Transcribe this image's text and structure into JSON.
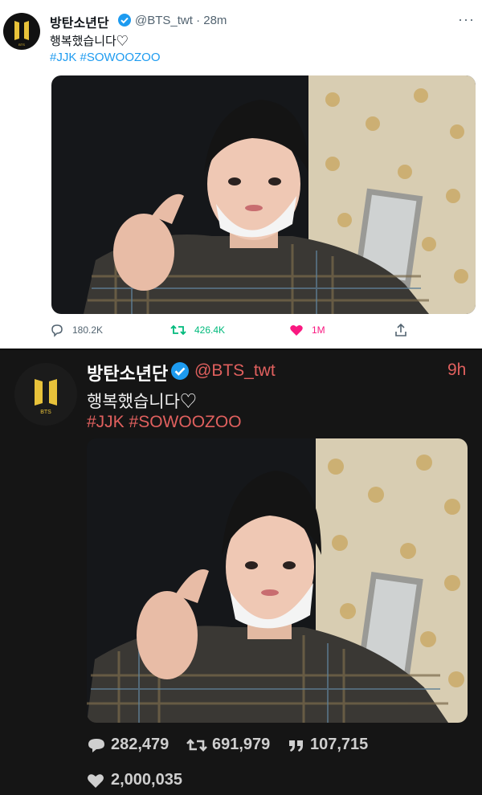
{
  "light_tweet": {
    "name": "방탄소년단",
    "handle": "@BTS_twt · 28m",
    "more": "···",
    "text": "행복했습니다♡",
    "hashtags": "#JJK #SOWOOZOO",
    "counts": {
      "replies": "180.2K",
      "retweets": "426.4K",
      "likes": "1M"
    },
    "colors": {
      "retweet": "#00ba7c",
      "like": "#f91880",
      "link": "#1d9bf0"
    },
    "avatar_logo": "BTS"
  },
  "dark_tweet": {
    "name": "방탄소년단",
    "handle": "@BTS_twt",
    "time": "9h",
    "text": "행복했습니다♡",
    "hashtags": "#JJK #SOWOOZOO",
    "counts": {
      "replies": "282,479",
      "retweets": "691,979",
      "quotes": "107,715",
      "likes": "2,000,035"
    },
    "colors": {
      "accent": "#e0605e",
      "background": "#151515"
    },
    "avatar_logo": "BTS"
  }
}
